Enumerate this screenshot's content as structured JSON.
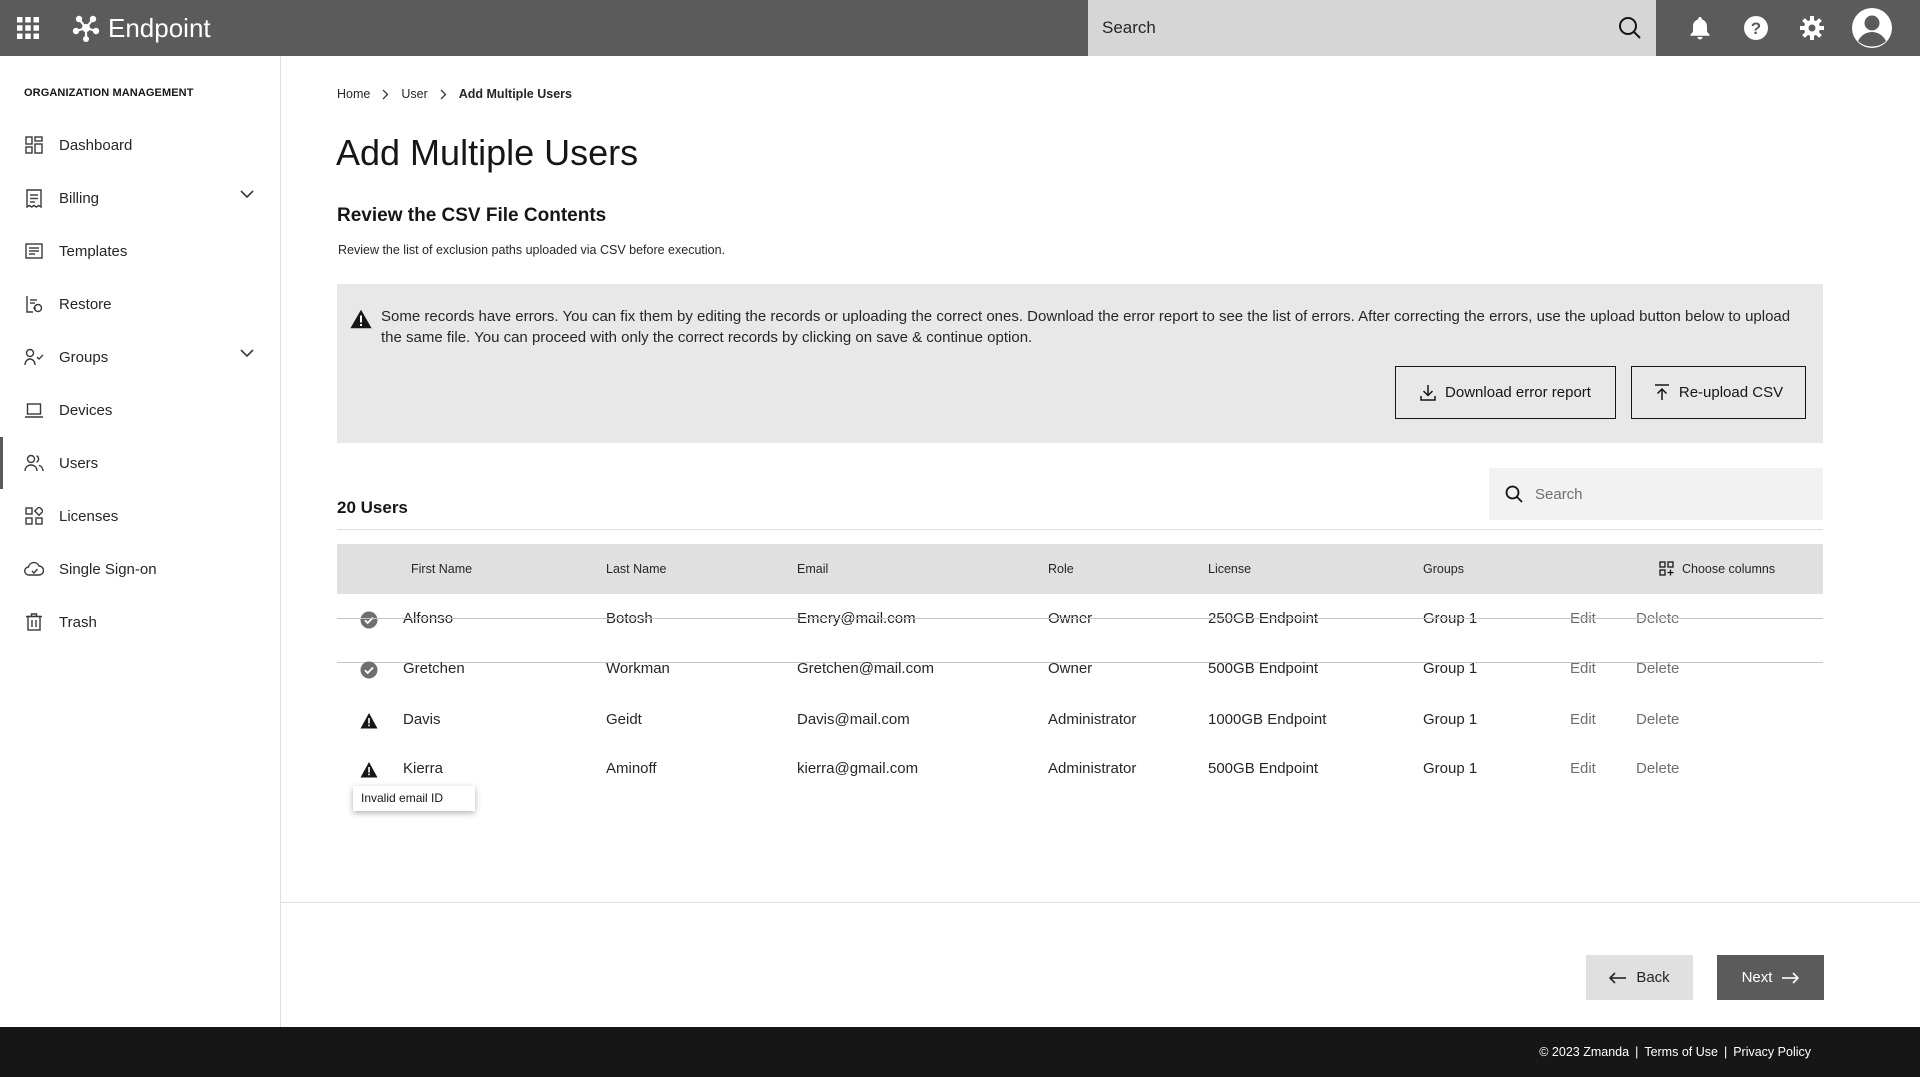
{
  "app": {
    "name": "Endpoint"
  },
  "topbar": {
    "search_placeholder": "Search"
  },
  "sidebar": {
    "section_title": "ORGANIZATION MANAGEMENT",
    "items": [
      {
        "label": "Dashboard",
        "icon": "dashboard-icon"
      },
      {
        "label": "Billing",
        "icon": "billing-icon",
        "expandable": true
      },
      {
        "label": "Templates",
        "icon": "templates-icon"
      },
      {
        "label": "Restore",
        "icon": "restore-icon"
      },
      {
        "label": "Groups",
        "icon": "groups-icon",
        "expandable": true
      },
      {
        "label": "Devices",
        "icon": "laptop-icon"
      },
      {
        "label": "Users",
        "icon": "users-icon",
        "active": true
      },
      {
        "label": "Licenses",
        "icon": "licenses-icon"
      },
      {
        "label": "Single Sign-on",
        "icon": "sso-icon"
      },
      {
        "label": "Trash",
        "icon": "trash-icon"
      }
    ]
  },
  "breadcrumb": {
    "home": "Home",
    "user": "User",
    "current": "Add Multiple Users"
  },
  "page": {
    "title": "Add Multiple Users",
    "section_title": "Review the CSV File Contents",
    "section_desc": "Review the list of exclusion paths uploaded via CSV before execution."
  },
  "alert": {
    "message": "Some records have errors. You can fix them by editing the records or uploading the correct ones. Download the error report to see the list of errors. After correcting the errors, use the upload button below to upload the same file. You can proceed with only the correct records by clicking on save & continue option.",
    "download_label": "Download error report",
    "reupload_label": "Re-upload CSV"
  },
  "table": {
    "count_label": "20 Users",
    "search_placeholder": "Search",
    "choose_columns_label": "Choose columns",
    "columns": [
      "First Name",
      "Last Name",
      "Email",
      "Role",
      "License",
      "Groups"
    ],
    "edit_label": "Edit",
    "delete_label": "Delete",
    "rows": [
      {
        "status": "ok",
        "first": "Alfonso",
        "last": "Botosh",
        "email": "Emery@mail.com",
        "role": "Owner",
        "license": "250GB Endpoint",
        "group": "Group 1"
      },
      {
        "status": "ok",
        "first": "Gretchen",
        "last": "Workman",
        "email": "Gretchen@mail.com",
        "role": "Owner",
        "license": "500GB Endpoint",
        "group": "Group 1"
      },
      {
        "status": "error",
        "first": "Davis",
        "last": "Geidt",
        "email": "Davis@mail.com",
        "role": "Administrator",
        "license": "1000GB Endpoint",
        "group": "Group 1"
      },
      {
        "status": "error",
        "first": "Kierra",
        "last": "Aminoff",
        "email": "kierra@gmail.com",
        "role": "Administrator",
        "license": "500GB Endpoint",
        "group": "Group 1"
      }
    ],
    "tooltip": "Invalid email ID"
  },
  "nav_buttons": {
    "back": "Back",
    "next": "Next"
  },
  "footer": {
    "copyright": "© 2023 Zmanda",
    "terms": "Terms of Use",
    "privacy": "Privacy Policy",
    "separator": "|"
  }
}
